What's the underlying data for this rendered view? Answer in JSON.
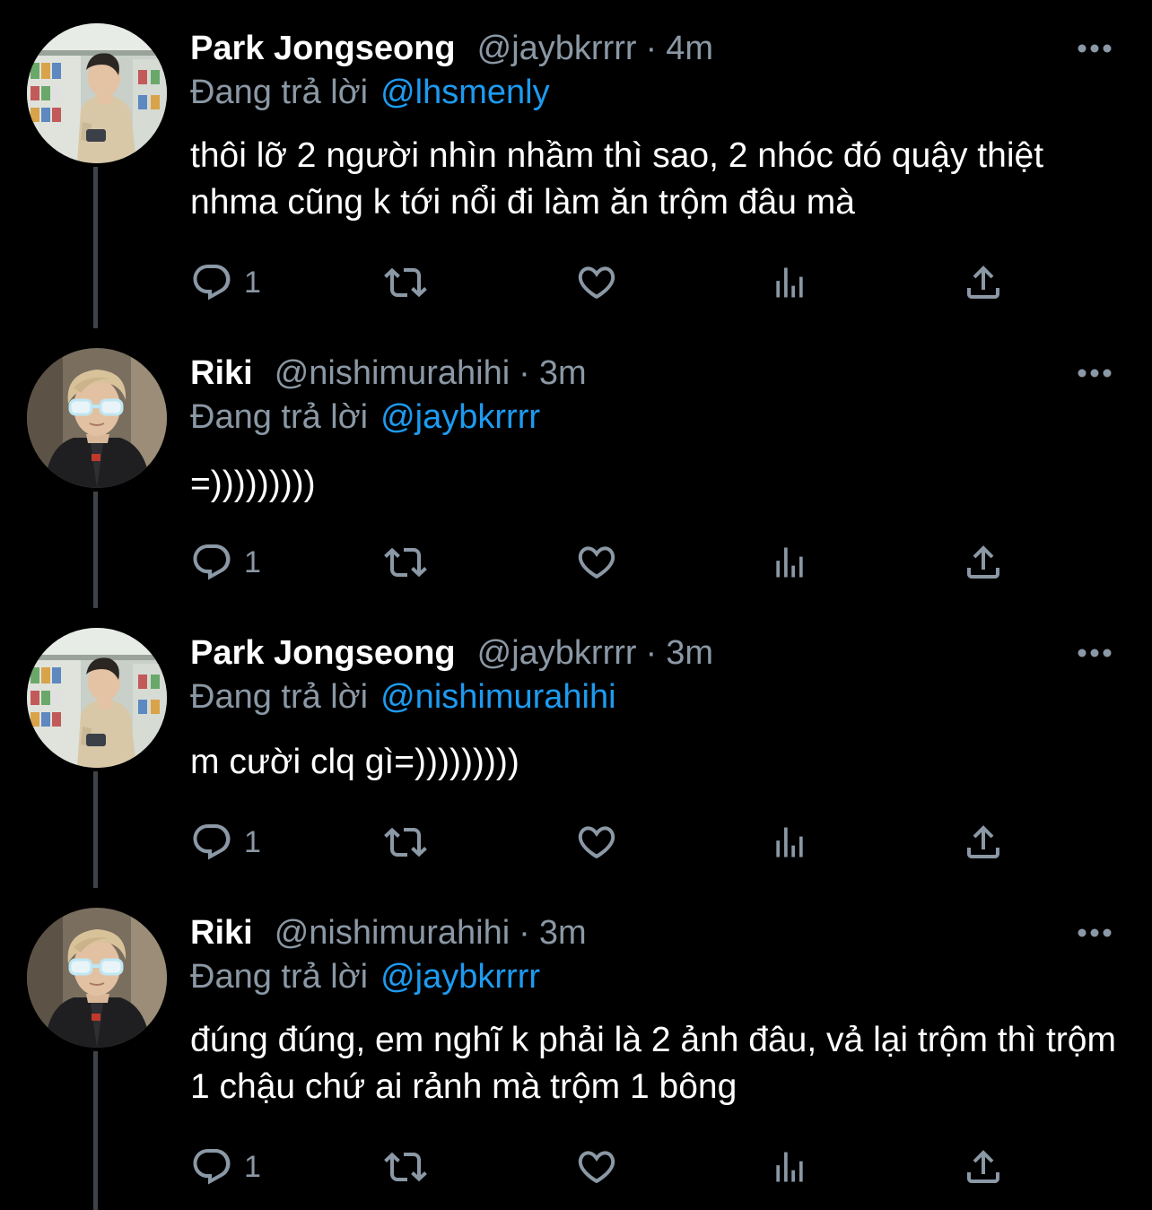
{
  "colors": {
    "background": "#000000",
    "text": "#ffffff",
    "muted": "#8b98a5",
    "link": "#1d9bf0",
    "thread_line": "#3d4349"
  },
  "tweets": [
    {
      "name": "Park Jongseong",
      "handle": "@jaybkrrrr",
      "separator": "·",
      "time": "4m",
      "replying_label": "Đang trả lời",
      "replying_to": "@lhsmenly",
      "body": "thôi lỡ 2 người nhìn nhầm thì sao, 2 nhóc đó quậy thiệt nhma cũng k tới nổi đi làm ăn trộm đâu mà",
      "reply_count": "1",
      "avatar_icon": "avatar-photo-store",
      "more_icon": "more-dots-icon"
    },
    {
      "name": "Riki",
      "handle": "@nishimurahihi",
      "separator": "·",
      "time": "3m",
      "replying_label": "Đang trả lời",
      "replying_to": "@jaybkrrrr",
      "body": "=)))))))))",
      "reply_count": "1",
      "avatar_icon": "avatar-photo-sunglasses",
      "more_icon": "more-dots-icon"
    },
    {
      "name": "Park Jongseong",
      "handle": "@jaybkrrrr",
      "separator": "·",
      "time": "3m",
      "replying_label": "Đang trả lời",
      "replying_to": "@nishimurahihi",
      "body": "m cười clq gì=)))))))))",
      "reply_count": "1",
      "avatar_icon": "avatar-photo-store",
      "more_icon": "more-dots-icon"
    },
    {
      "name": "Riki",
      "handle": "@nishimurahihi",
      "separator": "·",
      "time": "3m",
      "replying_label": "Đang trả lời",
      "replying_to": "@jaybkrrrr",
      "body": "đúng đúng, em nghĩ k phải là 2 ảnh đâu, vả lại trộm thì trộm 1 chậu chứ ai rảnh mà trộm 1 bông",
      "reply_count": "1",
      "avatar_icon": "avatar-photo-sunglasses",
      "more_icon": "more-dots-icon"
    }
  ],
  "action_icons": [
    "reply-icon",
    "retweet-icon",
    "like-icon",
    "analytics-icon",
    "share-icon"
  ]
}
